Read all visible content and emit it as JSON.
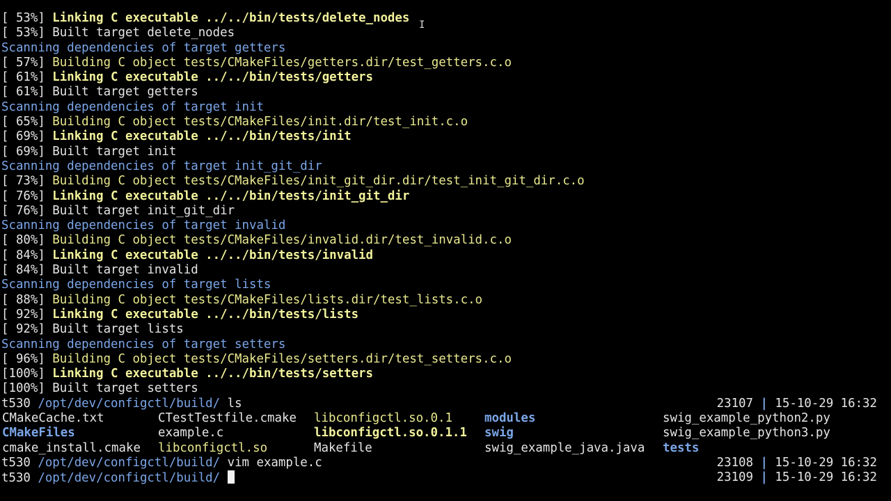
{
  "terminal": {
    "build_lines": [
      {
        "pct": "[ 53%]",
        "text": "Linking C executable ../../bin/tests/delete_nodes",
        "kind": "link"
      },
      {
        "pct": "[ 53%]",
        "text": "Built target delete_nodes",
        "kind": "built"
      },
      {
        "pct": "",
        "text": "Scanning dependencies of target getters",
        "kind": "scan"
      },
      {
        "pct": "[ 57%]",
        "text": "Building C object tests/CMakeFiles/getters.dir/test_getters.c.o",
        "kind": "build"
      },
      {
        "pct": "[ 61%]",
        "text": "Linking C executable ../../bin/tests/getters",
        "kind": "link"
      },
      {
        "pct": "[ 61%]",
        "text": "Built target getters",
        "kind": "built"
      },
      {
        "pct": "",
        "text": "Scanning dependencies of target init",
        "kind": "scan"
      },
      {
        "pct": "[ 65%]",
        "text": "Building C object tests/CMakeFiles/init.dir/test_init.c.o",
        "kind": "build"
      },
      {
        "pct": "[ 69%]",
        "text": "Linking C executable ../../bin/tests/init",
        "kind": "link"
      },
      {
        "pct": "[ 69%]",
        "text": "Built target init",
        "kind": "built"
      },
      {
        "pct": "",
        "text": "Scanning dependencies of target init_git_dir",
        "kind": "scan"
      },
      {
        "pct": "[ 73%]",
        "text": "Building C object tests/CMakeFiles/init_git_dir.dir/test_init_git_dir.c.o",
        "kind": "build"
      },
      {
        "pct": "[ 76%]",
        "text": "Linking C executable ../../bin/tests/init_git_dir",
        "kind": "link"
      },
      {
        "pct": "[ 76%]",
        "text": "Built target init_git_dir",
        "kind": "built"
      },
      {
        "pct": "",
        "text": "Scanning dependencies of target invalid",
        "kind": "scan"
      },
      {
        "pct": "[ 80%]",
        "text": "Building C object tests/CMakeFiles/invalid.dir/test_invalid.c.o",
        "kind": "build"
      },
      {
        "pct": "[ 84%]",
        "text": "Linking C executable ../../bin/tests/invalid",
        "kind": "link"
      },
      {
        "pct": "[ 84%]",
        "text": "Built target invalid",
        "kind": "built"
      },
      {
        "pct": "",
        "text": "Scanning dependencies of target lists",
        "kind": "scan"
      },
      {
        "pct": "[ 88%]",
        "text": "Building C object tests/CMakeFiles/lists.dir/test_lists.c.o",
        "kind": "build"
      },
      {
        "pct": "[ 92%]",
        "text": "Linking C executable ../../bin/tests/lists",
        "kind": "link"
      },
      {
        "pct": "[ 92%]",
        "text": "Built target lists",
        "kind": "built"
      },
      {
        "pct": "",
        "text": "Scanning dependencies of target setters",
        "kind": "scan"
      },
      {
        "pct": "[ 96%]",
        "text": "Building C object tests/CMakeFiles/setters.dir/test_setters.c.o",
        "kind": "build"
      },
      {
        "pct": "[100%]",
        "text": "Linking C executable ../../bin/tests/setters",
        "kind": "link"
      },
      {
        "pct": "[100%]",
        "text": "Built target setters",
        "kind": "built"
      }
    ],
    "prompt1": {
      "host": "t530",
      "cwd": "/opt/dev/configctl/build/",
      "cmd": "ls",
      "num": "23107",
      "sep": "|",
      "time": "15-10-29 16:32"
    },
    "ls_rows": [
      [
        {
          "name": "CMakeCache.txt",
          "type": "file"
        },
        {
          "name": "CTestTestfile.cmake",
          "type": "file"
        },
        {
          "name": "libconfigctl.so.0.1",
          "type": "link"
        },
        {
          "name": "modules",
          "type": "dir"
        },
        {
          "name": "swig_example_python2.py",
          "type": "file"
        }
      ],
      [
        {
          "name": "CMakeFiles",
          "type": "dir"
        },
        {
          "name": "example.c",
          "type": "file"
        },
        {
          "name": "libconfigctl.so.0.1.1",
          "type": "exec"
        },
        {
          "name": "swig",
          "type": "dir"
        },
        {
          "name": "swig_example_python3.py",
          "type": "file"
        }
      ],
      [
        {
          "name": "cmake_install.cmake",
          "type": "file"
        },
        {
          "name": "libconfigctl.so",
          "type": "link"
        },
        {
          "name": "Makefile",
          "type": "file"
        },
        {
          "name": "swig_example_java.java",
          "type": "file"
        },
        {
          "name": "tests",
          "type": "dir"
        }
      ]
    ],
    "prompt2": {
      "host": "t530",
      "cwd": "/opt/dev/configctl/build/",
      "cmd": "vim example.c",
      "num": "23108",
      "sep": "|",
      "time": "15-10-29 16:32"
    },
    "prompt3": {
      "host": "t530",
      "cwd": "/opt/dev/configctl/build/",
      "cmd": "",
      "num": "23109",
      "sep": "|",
      "time": "15-10-29 16:32"
    },
    "colors": {
      "background": "#000000",
      "text": "#e6e6e6",
      "yellow": "#e9e98f",
      "blue": "#7ba6e8"
    }
  }
}
